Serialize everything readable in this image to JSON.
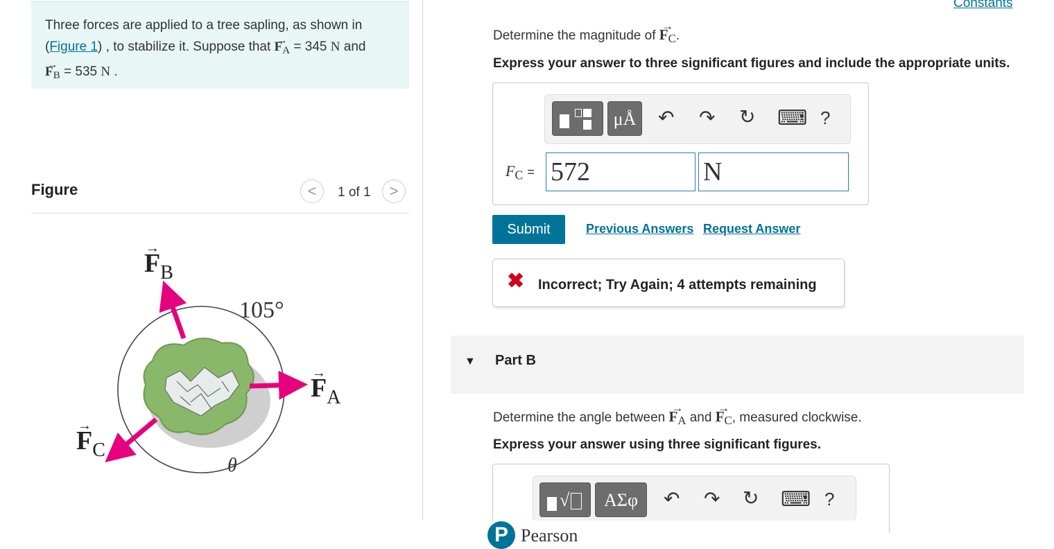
{
  "constants_link": "Constants",
  "problem": {
    "text_1": "Three forces are applied to a tree sapling, as shown in",
    "paren_open": "(",
    "figure_link": "Figure 1",
    "text_2": ") , to stabilize it. Suppose that",
    "fa_symbol": "F",
    "fa_sub": "A",
    "fa_value": "= 345",
    "unit_n": "N",
    "and": "and",
    "fb_symbol": "F",
    "fb_sub": "B",
    "fb_value": "= 535",
    "unit_n2": "N",
    "period": "."
  },
  "figure": {
    "title": "Figure",
    "prev": "<",
    "count": "1 of 1",
    "next": ">",
    "label_fb_sub": "B",
    "label_fa_sub": "A",
    "label_fc_sub": "C",
    "label_f": "F",
    "angle_label": "105°",
    "theta_label": "θ"
  },
  "part_a": {
    "prompt_prefix": "Determine the magnitude of",
    "prompt_sym": "F",
    "prompt_sub": "C",
    "prompt_suffix": ".",
    "instruction": "Express your answer to three significant figures and include the appropriate units.",
    "toolbar": {
      "templates": "",
      "units": "μÅ",
      "undo": "↶",
      "redo": "↷",
      "reset": "↻",
      "keyboard": "⌨",
      "help": "?"
    },
    "var_label": "F",
    "var_sub": "C",
    "equals": "=",
    "value": "572",
    "unit": "N",
    "submit": "Submit",
    "previous_answers": "Previous Answers",
    "request_answer": "Request Answer",
    "feedback": "Incorrect; Try Again; 4 attempts remaining",
    "feedback_color": "#d0021b"
  },
  "part_b": {
    "title": "Part B",
    "prompt_prefix": "Determine the angle between",
    "sym_a": "F",
    "sub_a": "A",
    "and": "and",
    "sym_c": "F",
    "sub_c": "C",
    "prompt_suffix": ", measured clockwise.",
    "instruction": "Express your answer using three significant figures.",
    "toolbar": {
      "templates": "√",
      "greek": "ΑΣφ",
      "undo": "↶",
      "redo": "↷",
      "reset": "↻",
      "keyboard": "⌨",
      "help": "?"
    }
  },
  "footer": {
    "brand": "Pearson"
  },
  "colors": {
    "accent": "#007398",
    "force_arrow": "#e6007e",
    "panel": "#e8f6f6"
  }
}
